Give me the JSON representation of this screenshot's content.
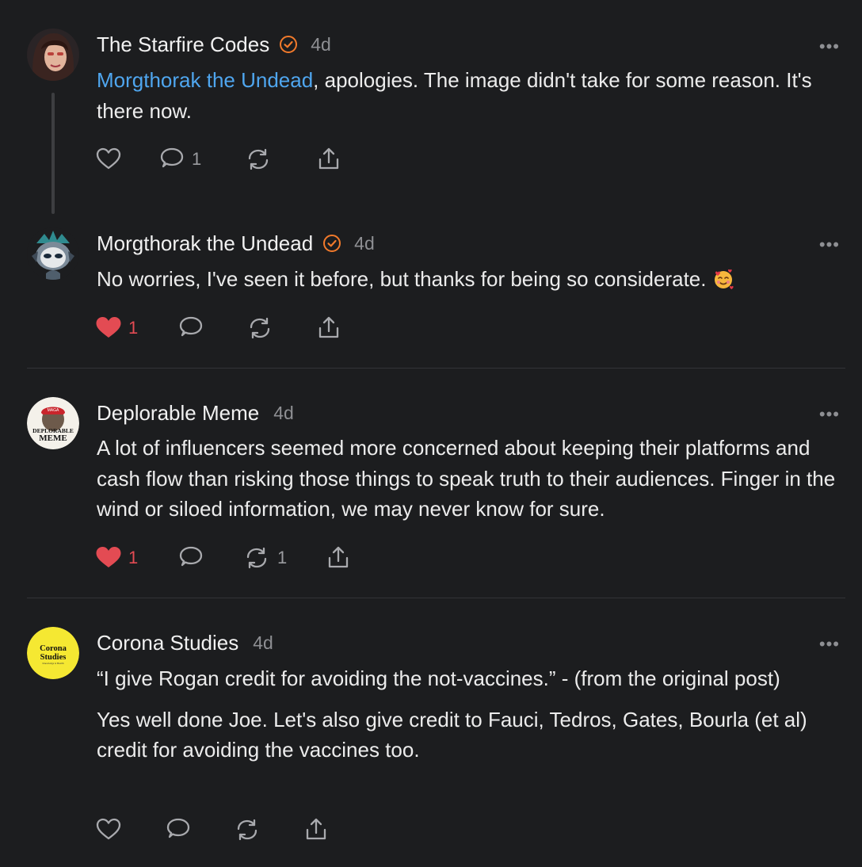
{
  "comments": [
    {
      "author": "The Starfire Codes",
      "verified": true,
      "time": "4d",
      "more": "•••",
      "mention": "Morgthorak the Undead",
      "text": ", apologies. The image didn't take for some reason. It's there now.",
      "likes": "",
      "replies": "1",
      "restacks": ""
    },
    {
      "author": "Morgthorak the Undead",
      "verified": true,
      "time": "4d",
      "more": "•••",
      "text": "No worries, I've seen it before, but thanks for being so considerate.",
      "emoji": "smiling-face-with-hearts",
      "likes": "1",
      "liked": true,
      "replies": "",
      "restacks": ""
    },
    {
      "author": "Deplorable Meme",
      "verified": false,
      "time": "4d",
      "more": "•••",
      "text": "A lot of influencers seemed more concerned about keeping their platforms and cash flow than risking those things to speak truth to their audiences. Finger in the wind or siloed information, we may never know for sure.",
      "avatar_text": [
        "MAGA",
        "DEPLORABLE",
        "MEME"
      ],
      "likes": "1",
      "liked": true,
      "replies": "",
      "restacks": "1"
    },
    {
      "author": "Corona Studies",
      "verified": false,
      "time": "4d",
      "more": "•••",
      "paragraphs": [
        "“I give Rogan credit for avoiding the not-vaccines.” - (from the original post)",
        "Yes well done Joe. Let's also give credit to Fauci, Tedros, Gates, Bourla (et al) credit for avoiding the vaccines too."
      ],
      "avatar_text": [
        "Corona",
        "Studies",
        "Knowledge is Health"
      ],
      "likes": "",
      "replies": "",
      "restacks": ""
    }
  ],
  "colors": {
    "background": "#1c1d1f",
    "accent_link": "#4fa6ef",
    "verified": "#f27a2b",
    "liked": "#e34b53",
    "muted": "#8e8f93"
  }
}
